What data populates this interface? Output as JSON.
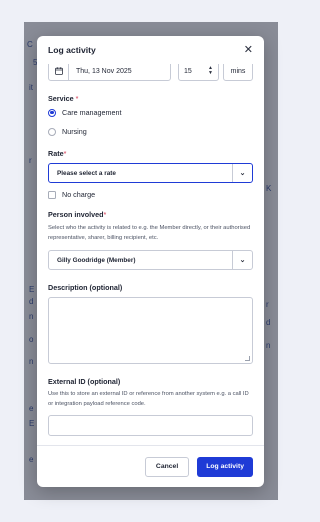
{
  "background": {
    "fragments": [
      "C",
      "5",
      "it",
      "r",
      "K",
      "E",
      "d",
      "n",
      "r",
      "d",
      "o",
      "n",
      "n",
      "e",
      "E",
      "e"
    ]
  },
  "modal": {
    "title": "Log activity",
    "close_icon": "close-icon",
    "date": {
      "icon": "calendar-icon",
      "value": "Thu, 13 Nov 2025"
    },
    "duration": {
      "value": "15",
      "unit": "mins"
    },
    "service": {
      "label": "Service",
      "required_mark": "*",
      "options": [
        {
          "label": "Care management",
          "selected": true
        },
        {
          "label": "Nursing",
          "selected": false
        }
      ]
    },
    "rate": {
      "label": "Rate",
      "required_mark": "*",
      "placeholder": "Please select a rate",
      "no_charge_label": "No charge"
    },
    "person": {
      "label": "Person involved",
      "required_mark": "*",
      "help": "Select who the activity is related to e.g. the Member directly, or their authorised representative, sharer, billing recipient, etc.",
      "value": "Gilly Goodridge (Member)"
    },
    "description": {
      "label": "Description (optional)"
    },
    "external_id": {
      "label": "External ID (optional)",
      "help": "Use this to store an external ID or reference from another system e.g. a call ID or integration payload reference code."
    },
    "footer": {
      "cancel_label": "Cancel",
      "submit_label": "Log activity"
    }
  },
  "colors": {
    "accent": "#1f3bd6",
    "required": "#d3304a",
    "overlay": "#5b6072"
  }
}
